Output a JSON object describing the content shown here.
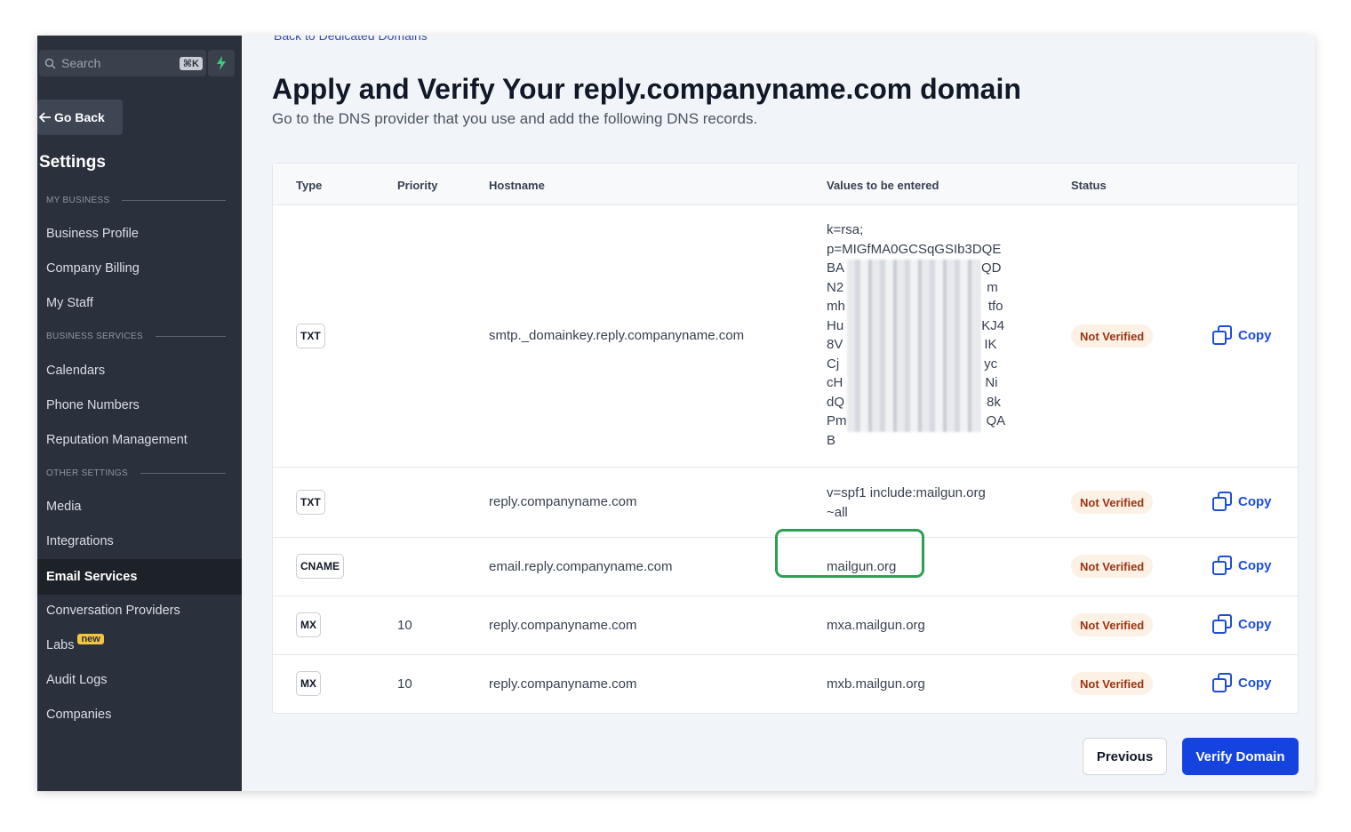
{
  "sidebar": {
    "search_placeholder": "Search",
    "search_shortcut": "⌘K",
    "go_back": "Go Back",
    "title": "Settings",
    "sections": {
      "my_business": "MY BUSINESS",
      "business_services": "BUSINESS SERVICES",
      "other_settings": "OTHER SETTINGS"
    },
    "items": {
      "business_profile": "Business Profile",
      "company_billing": "Company Billing",
      "my_staff": "My Staff",
      "calendars": "Calendars",
      "phone_numbers": "Phone Numbers",
      "reputation_management": "Reputation Management",
      "media": "Media",
      "integrations": "Integrations",
      "email_services": "Email Services",
      "conversation_providers": "Conversation Providers",
      "labs": "Labs",
      "labs_badge": "new",
      "audit_logs": "Audit Logs",
      "companies": "Companies"
    }
  },
  "main": {
    "back_link": "Back to Dedicated Domains",
    "title": "Apply and Verify Your reply.companyname.com domain",
    "subtitle": "Go to the DNS provider that you use and add the following DNS records.",
    "columns": {
      "type": "Type",
      "priority": "Priority",
      "hostname": "Hostname",
      "values": "Values to be entered",
      "status": "Status"
    },
    "rows": [
      {
        "type": "TXT",
        "priority": "",
        "hostname": "smtp._domainkey.reply.companyname.com",
        "value_lines": [
          "k=rsa;",
          "p=MIGfMA0GCSqGSIb3DQE",
          "BA",
          "N2",
          "mh",
          "Hu",
          "8V",
          "Cj",
          "cH",
          "dQ",
          "Pm",
          "B"
        ],
        "value_tails": [
          "",
          "",
          "QD",
          "m",
          "tfo",
          "KJ4",
          "IK",
          "yc",
          "Ni",
          "8k",
          "QA",
          ""
        ],
        "status": "Not Verified",
        "copy": "Copy"
      },
      {
        "type": "TXT",
        "priority": "",
        "hostname": "reply.companyname.com",
        "value_line1": "v=spf1 include:mailgun.org",
        "value_line2": "~all",
        "status": "Not Verified",
        "copy": "Copy"
      },
      {
        "type": "CNAME",
        "priority": "",
        "hostname": "email.reply.companyname.com",
        "value": "mailgun.org",
        "status": "Not Verified",
        "copy": "Copy"
      },
      {
        "type": "MX",
        "priority": "10",
        "hostname": "reply.companyname.com",
        "value": "mxa.mailgun.org",
        "status": "Not Verified",
        "copy": "Copy"
      },
      {
        "type": "MX",
        "priority": "10",
        "hostname": "reply.companyname.com",
        "value": "mxb.mailgun.org",
        "status": "Not Verified",
        "copy": "Copy"
      }
    ],
    "previous": "Previous",
    "verify": "Verify Domain"
  },
  "colors": {
    "sidebar_bg": "#2b313c",
    "primary": "#1543e0",
    "status_bg": "#fdf1e6",
    "status_text": "#9a3412",
    "highlight": "#2e9e52"
  }
}
